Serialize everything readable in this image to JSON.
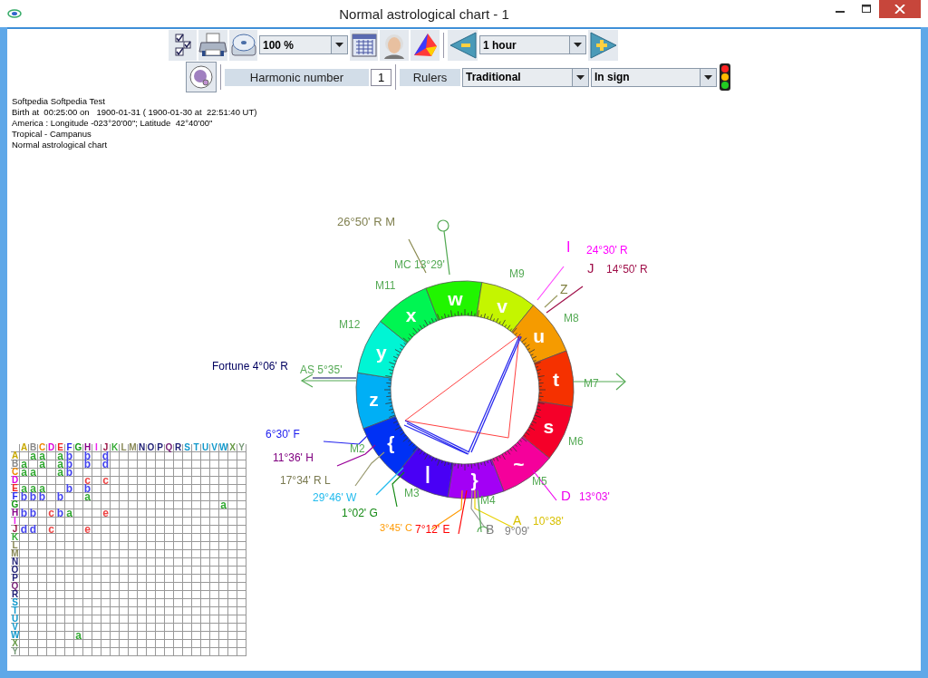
{
  "window": {
    "title": "Normal astrological chart - 1"
  },
  "toolbar": {
    "zoom": {
      "value": "100 %"
    },
    "step": {
      "value": "1 hour"
    }
  },
  "options": {
    "harmonic_label": "Harmonic number",
    "harmonic_value": "1",
    "rulers_label": "Rulers",
    "rulers": {
      "value": "Traditional"
    },
    "mode": {
      "value": "In sign"
    }
  },
  "info": [
    "Softpedia Softpedia Test",
    "Birth at  00:25:00 on   1900-01-31 ( 1900-01-30 at  22:51:40 UT)",
    "America : Longitude -023°20'00\"; Latitude  42°40'00\"",
    "Tropical - Campanus",
    "Normal astrological chart"
  ],
  "chart": {
    "signs": [
      "z",
      "y",
      "x",
      "w",
      "v",
      "u",
      "t",
      "s",
      "~",
      "}",
      "|",
      "{"
    ],
    "labels": [
      {
        "text": "26°50' R M",
        "color": "#808050"
      },
      {
        "text": "I",
        "color": "#ff00ff"
      },
      {
        "text": "24°30' R",
        "color": "#ff00ff"
      },
      {
        "text": "MC 13°29'",
        "color": "#55aa55"
      },
      {
        "text": "M9",
        "color": "#55aa55"
      },
      {
        "text": "J",
        "color": "#a0104a"
      },
      {
        "text": "14°50' R",
        "color": "#a0104a"
      },
      {
        "text": "M11",
        "color": "#55aa55"
      },
      {
        "text": "Z",
        "color": "#808040"
      },
      {
        "text": "M8",
        "color": "#55aa55"
      },
      {
        "text": "M12",
        "color": "#55aa55"
      },
      {
        "text": "Fortune 4°06' R",
        "color": "#000060"
      },
      {
        "text": "AS  5°35'",
        "color": "#55aa55"
      },
      {
        "text": "M7",
        "color": "#55aa55"
      },
      {
        "text": "6°30' F",
        "color": "#1a1aee"
      },
      {
        "text": "M6",
        "color": "#55aa55"
      },
      {
        "text": "M2",
        "color": "#55aa55"
      },
      {
        "text": "11°36' H",
        "color": "#800080"
      },
      {
        "text": "17°34' R L",
        "color": "#7a7a50"
      },
      {
        "text": "M5",
        "color": "#55aa55"
      },
      {
        "text": "29°46' W",
        "color": "#22bbee"
      },
      {
        "text": "M3",
        "color": "#55aa55"
      },
      {
        "text": "M4",
        "color": "#55aa55"
      },
      {
        "text": "D",
        "color": "#ee00ee"
      },
      {
        "text": "13°03'",
        "color": "#ee00ee"
      },
      {
        "text": "1°02' G",
        "color": "#118811"
      },
      {
        "text": "3°45' C",
        "color": "#ff9900"
      },
      {
        "text": "7°12' E",
        "color": "#ff0000"
      },
      {
        "text": "A",
        "color": "#d8c000"
      },
      {
        "text": "10°38'",
        "color": "#d8c000"
      },
      {
        "text": "B",
        "color": "#808080"
      },
      {
        "text": "9°09'",
        "color": "#808080"
      }
    ]
  },
  "aspect_grid": {
    "columns": [
      {
        "label": "A",
        "color": "#c8a800"
      },
      {
        "label": "B",
        "color": "#888888"
      },
      {
        "label": "C",
        "color": "#ee8800"
      },
      {
        "label": "D",
        "color": "#dd00dd"
      },
      {
        "label": "E",
        "color": "#ee2222"
      },
      {
        "label": "F",
        "color": "#2222ee"
      },
      {
        "label": "G",
        "color": "#119911"
      },
      {
        "label": "H",
        "color": "#880088"
      },
      {
        "label": "I",
        "color": "#ee22ee"
      },
      {
        "label": "J",
        "color": "#991144"
      },
      {
        "label": "K",
        "color": "#33aa33"
      },
      {
        "label": "L",
        "color": "#888855"
      },
      {
        "label": "M",
        "color": "#888855"
      },
      {
        "label": "N",
        "color": "#222277"
      },
      {
        "label": "O",
        "color": "#222277"
      },
      {
        "label": "P",
        "color": "#222277"
      },
      {
        "label": "Q",
        "color": "#772277"
      },
      {
        "label": "R",
        "color": "#222277"
      },
      {
        "label": "S",
        "color": "#1199cc"
      },
      {
        "label": "T",
        "color": "#1199cc"
      },
      {
        "label": "U",
        "color": "#1199cc"
      },
      {
        "label": "V",
        "color": "#1199cc"
      },
      {
        "label": "W",
        "color": "#1199cc"
      },
      {
        "label": "X",
        "color": "#669944"
      },
      {
        "label": "Y",
        "color": "#779977"
      }
    ],
    "rows": [
      {
        "label": "A",
        "color": "#c8a800",
        "cells": [
          null,
          {
            "text": "a",
            "color": "#33aa33"
          },
          {
            "text": "a",
            "color": "#33aa33"
          },
          null,
          {
            "text": "a",
            "color": "#33aa33"
          },
          {
            "text": "b",
            "color": "#4444ee"
          },
          null,
          {
            "text": "b",
            "color": "#4444ee"
          },
          null,
          {
            "text": "d",
            "color": "#4444ee"
          }
        ]
      },
      {
        "label": "B",
        "color": "#888888",
        "cells": [
          {
            "text": "a",
            "color": "#33aa33"
          },
          null,
          {
            "text": "a",
            "color": "#33aa33"
          },
          null,
          {
            "text": "a",
            "color": "#33aa33"
          },
          {
            "text": "b",
            "color": "#4444ee"
          },
          null,
          {
            "text": "b",
            "color": "#4444ee"
          },
          null,
          {
            "text": "d",
            "color": "#4444ee"
          }
        ]
      },
      {
        "label": "C",
        "color": "#ee8800",
        "cells": [
          {
            "text": "a",
            "color": "#33aa33"
          },
          {
            "text": "a",
            "color": "#33aa33"
          },
          null,
          null,
          {
            "text": "a",
            "color": "#33aa33"
          },
          {
            "text": "b",
            "color": "#4444ee"
          }
        ]
      },
      {
        "label": "D",
        "color": "#dd00dd",
        "cells": [
          null,
          null,
          null,
          null,
          null,
          null,
          null,
          {
            "text": "c",
            "color": "#ee4444"
          },
          null,
          {
            "text": "c",
            "color": "#ee4444"
          }
        ]
      },
      {
        "label": "E",
        "color": "#ee2222",
        "cells": [
          {
            "text": "a",
            "color": "#33aa33"
          },
          {
            "text": "a",
            "color": "#33aa33"
          },
          {
            "text": "a",
            "color": "#33aa33"
          },
          null,
          null,
          {
            "text": "b",
            "color": "#4444ee"
          },
          null,
          {
            "text": "b",
            "color": "#4444ee"
          }
        ]
      },
      {
        "label": "F",
        "color": "#2222ee",
        "cells": [
          {
            "text": "b",
            "color": "#4444ee"
          },
          {
            "text": "b",
            "color": "#4444ee"
          },
          {
            "text": "b",
            "color": "#4444ee"
          },
          null,
          {
            "text": "b",
            "color": "#4444ee"
          },
          null,
          null,
          {
            "text": "a",
            "color": "#33aa33"
          }
        ]
      },
      {
        "label": "G",
        "color": "#119911",
        "cells": [
          null,
          null,
          null,
          null,
          null,
          null,
          null,
          null,
          null,
          null,
          null,
          null,
          null,
          null,
          null,
          null,
          null,
          null,
          null,
          null,
          null,
          null,
          {
            "text": "a",
            "color": "#33aa33"
          }
        ]
      },
      {
        "label": "H",
        "color": "#880088",
        "cells": [
          {
            "text": "b",
            "color": "#4444ee"
          },
          {
            "text": "b",
            "color": "#4444ee"
          },
          null,
          {
            "text": "c",
            "color": "#ee4444"
          },
          {
            "text": "b",
            "color": "#4444ee"
          },
          {
            "text": "a",
            "color": "#33aa33"
          },
          null,
          null,
          null,
          {
            "text": "e",
            "color": "#ee4444"
          }
        ]
      },
      {
        "label": "I",
        "color": "#ee22ee"
      },
      {
        "label": "J",
        "color": "#991144",
        "cells": [
          {
            "text": "d",
            "color": "#4444ee"
          },
          {
            "text": "d",
            "color": "#4444ee"
          },
          null,
          {
            "text": "c",
            "color": "#ee4444"
          },
          null,
          null,
          null,
          {
            "text": "e",
            "color": "#ee4444"
          }
        ]
      },
      {
        "label": "K",
        "color": "#33aa33"
      },
      {
        "label": "L",
        "color": "#888855"
      },
      {
        "label": "M",
        "color": "#888855"
      },
      {
        "label": "N",
        "color": "#222277"
      },
      {
        "label": "O",
        "color": "#222277"
      },
      {
        "label": "P",
        "color": "#222277"
      },
      {
        "label": "Q",
        "color": "#772277"
      },
      {
        "label": "R",
        "color": "#222277"
      },
      {
        "label": "S",
        "color": "#1199cc"
      },
      {
        "label": "T",
        "color": "#1199cc"
      },
      {
        "label": "U",
        "color": "#1199cc"
      },
      {
        "label": "V",
        "color": "#1199cc"
      },
      {
        "label": "W",
        "color": "#1199cc",
        "cells": [
          null,
          null,
          null,
          null,
          null,
          null,
          {
            "text": "a",
            "color": "#33aa33"
          }
        ]
      },
      {
        "label": "X",
        "color": "#669944"
      },
      {
        "label": "Y",
        "color": "#779977"
      }
    ]
  }
}
